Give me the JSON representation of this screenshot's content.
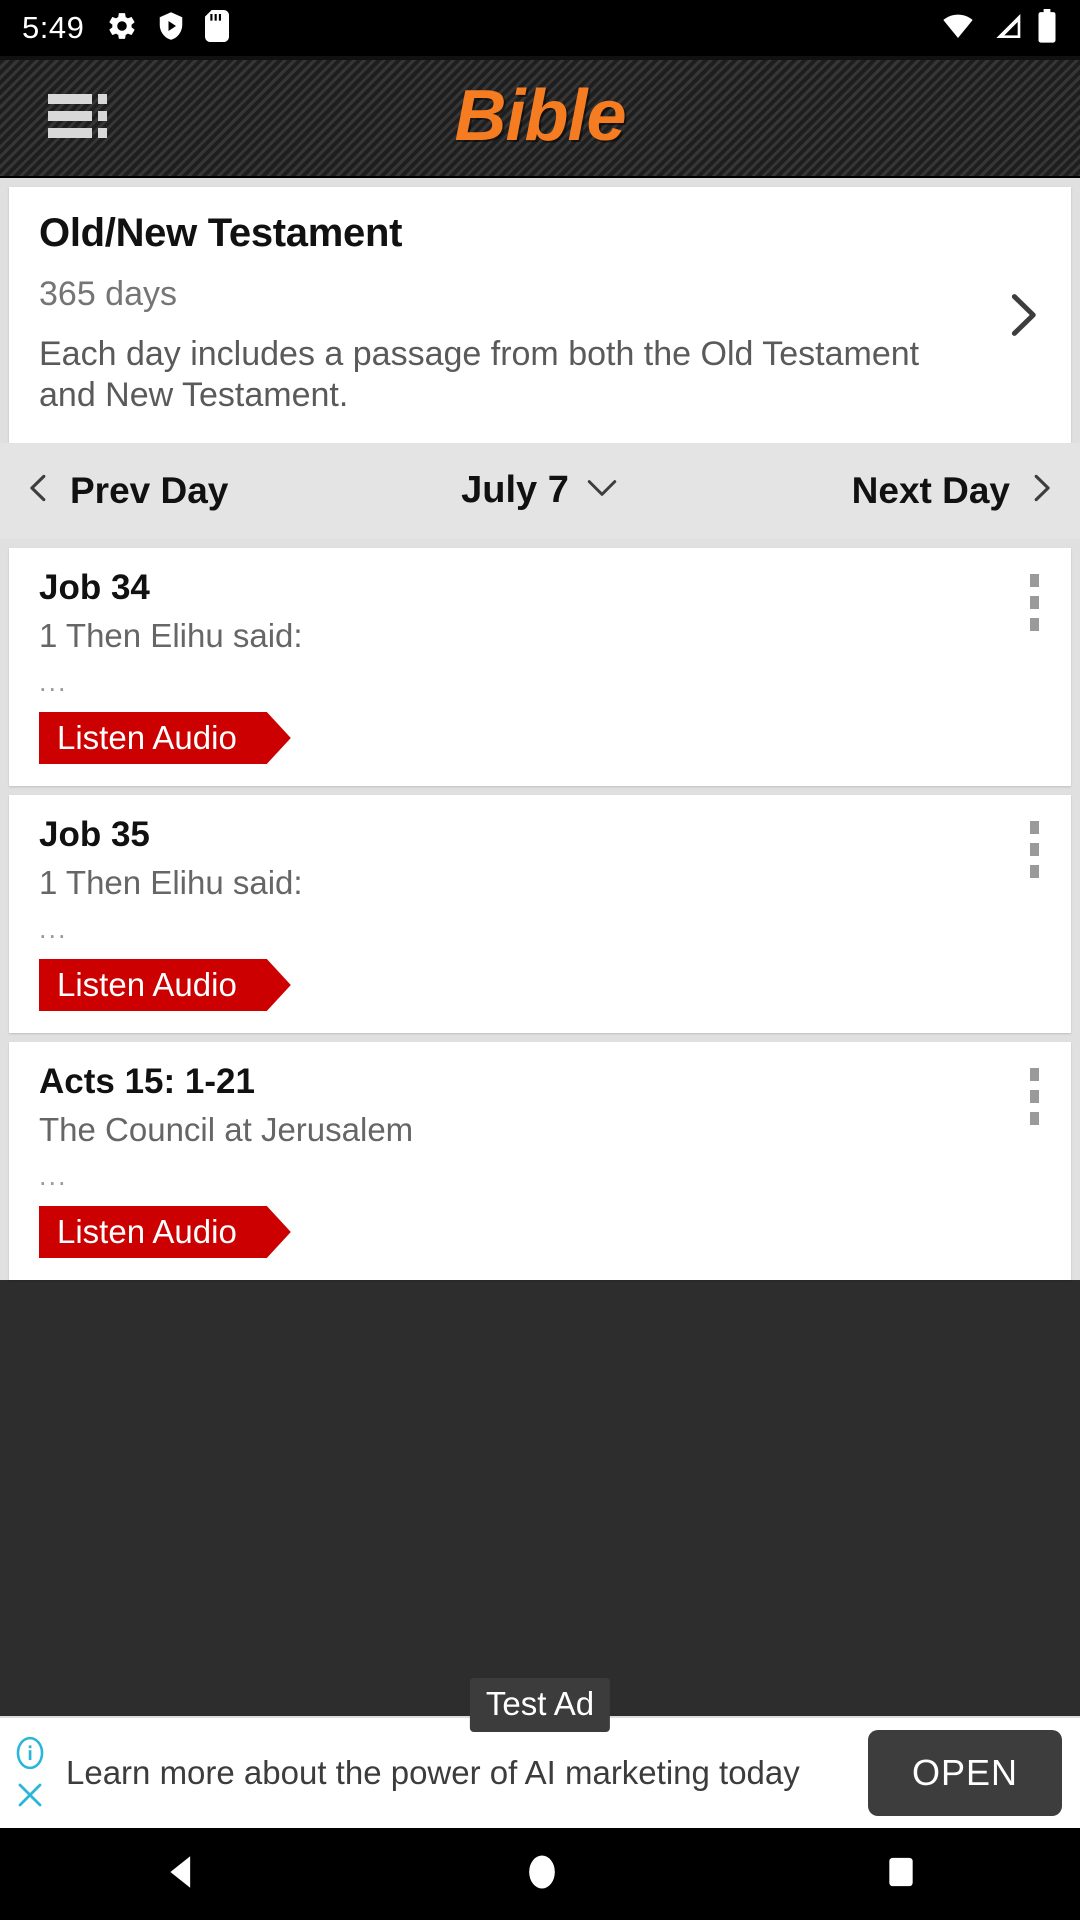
{
  "status_bar": {
    "time": "5:49",
    "left_icons": [
      "gear-icon",
      "play-protect-icon",
      "sd-card-icon"
    ],
    "right_icons": [
      "wifi-icon",
      "cellular-signal-icon",
      "battery-icon"
    ]
  },
  "app_bar": {
    "menu_icon": "list-menu-icon",
    "title": "Bible",
    "title_color": "#F57C20"
  },
  "plan_card": {
    "title": "Old/New Testament",
    "duration": "365 days",
    "description": "Each day includes a passage from both the Old Testament and New Testament.",
    "chevron_icon": "chevron-right-icon"
  },
  "day_nav": {
    "prev_label": "Prev Day",
    "date": "July 7",
    "next_label": "Next Day",
    "prev_icon": "chevron-left-icon",
    "next_icon": "chevron-right-icon",
    "dropdown_icon": "chevron-down-icon"
  },
  "passages": [
    {
      "reference": "Job 34",
      "preview": "1 Then Elihu said:",
      "ellipsis": "...",
      "audio_label": "Listen Audio",
      "menu_icon": "kebab-menu-icon"
    },
    {
      "reference": "Job 35",
      "preview": "1 Then Elihu said:",
      "ellipsis": "...",
      "audio_label": "Listen Audio",
      "menu_icon": "kebab-menu-icon"
    },
    {
      "reference": "Acts 15: 1-21",
      "preview": "The Council at Jerusalem",
      "ellipsis": "...",
      "audio_label": "Listen Audio",
      "menu_icon": "kebab-menu-icon"
    }
  ],
  "ad": {
    "badge": "Test Ad",
    "text": "Learn more about the power of AI marketing today",
    "cta_label": "OPEN",
    "info_icon": "info-circle-icon",
    "close_icon": "close-x-icon",
    "accent_color": "#29B6D8"
  },
  "android_nav": {
    "back_icon": "back-triangle-icon",
    "home_icon": "home-circle-icon",
    "recents_icon": "recents-square-icon"
  },
  "colors": {
    "audio_red": "#CC0000",
    "brand_orange": "#F57C20",
    "page_bg": "#E0E0E0"
  }
}
